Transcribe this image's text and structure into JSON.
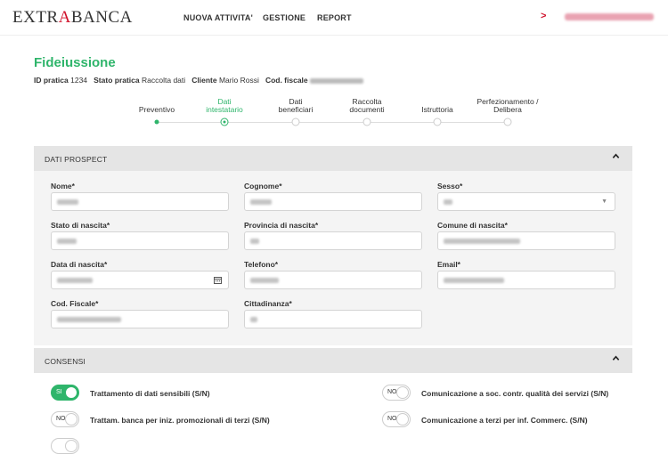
{
  "brand": {
    "part1": "EXTR",
    "part2": "A",
    "part3": "BANCA"
  },
  "nav": [
    "NUOVA ATTIVITA'",
    "GESTIONE",
    "REPORT"
  ],
  "user": {
    "chevron": ">"
  },
  "page": {
    "title": "Fideiussione"
  },
  "meta": {
    "id_label": "ID pratica",
    "id_value": "1234",
    "stato_label": "Stato pratica",
    "stato_value": "Raccolta dati",
    "cliente_label": "Cliente",
    "cliente_value": "Mario Rossi",
    "cf_label": "Cod. fiscale"
  },
  "steps": [
    {
      "l1": "Preventivo",
      "l2": ""
    },
    {
      "l1": "Dati",
      "l2": "intestatario"
    },
    {
      "l1": "Dati",
      "l2": "beneficiari"
    },
    {
      "l1": "Raccolta",
      "l2": "documenti"
    },
    {
      "l1": "Istruttoria",
      "l2": ""
    },
    {
      "l1": "Perfezionamento /",
      "l2": "Delibera"
    }
  ],
  "prospect": {
    "title": "DATI PROSPECT",
    "labels": {
      "nome": "Nome*",
      "cognome": "Cognome*",
      "sesso": "Sesso*",
      "stato_nascita": "Stato di nascita*",
      "provincia": "Provincia di nascita*",
      "comune": "Comune di nascita*",
      "data_nascita": "Data di nascita*",
      "telefono": "Telefono*",
      "email": "Email*",
      "cf": "Cod. Fiscale*",
      "cittadinanza": "Cittadinanza*"
    }
  },
  "consensi": {
    "title": "CONSENSI",
    "items": [
      {
        "state": "SI",
        "label": "Trattamento di dati sensibili (S/N)"
      },
      {
        "state": "NO",
        "label": "Comunicazione a soc. contr. qualità dei servizi (S/N)"
      },
      {
        "state": "NO",
        "label": "Trattam. banca per iniz. promozionali di terzi (S/N)"
      },
      {
        "state": "NO",
        "label": "Comunicazione a terzi per inf. Commerc. (S/N)"
      }
    ]
  },
  "colors": {
    "brand_red": "#d0112b",
    "accent_green": "#2fb56b"
  },
  "icons": {
    "calendar": "calendar-icon",
    "chevron_up": "chevron-up-icon",
    "dropdown": "chevron-down-icon"
  }
}
